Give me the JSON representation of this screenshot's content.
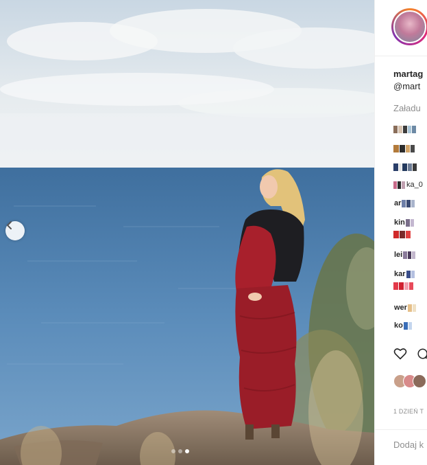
{
  "post": {
    "username": "martag",
    "handle": "@mart",
    "loading_text": "Załadu",
    "timestamp": "1 DZIEŃ T",
    "add_comment_placeholder": "Dodaj k"
  },
  "comments": [
    {
      "text": ""
    },
    {
      "text": ""
    },
    {
      "text": ""
    },
    {
      "text": "ka_0"
    },
    {
      "text": "ar"
    },
    {
      "text": "kin"
    },
    {
      "text": "lei"
    },
    {
      "text": "kar"
    },
    {
      "text": "wer"
    },
    {
      "text": "ko"
    }
  ],
  "carousel": {
    "slides": 3,
    "active_index": 2
  },
  "colors": {
    "accent": "#262626",
    "muted": "#8e8e8e",
    "border": "#efefef",
    "dress": "#a8202c"
  },
  "icons": [
    "chevron-left-icon",
    "heart-icon",
    "comment-icon"
  ]
}
